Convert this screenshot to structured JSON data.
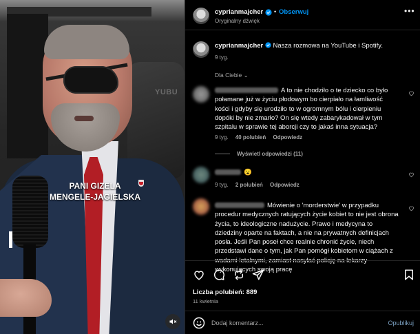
{
  "video": {
    "studio_sign": "YUBU",
    "caption_line1": "PANI GIZELA",
    "caption_line2": "MENGELE-JAGIELSKA"
  },
  "header": {
    "username": "cyprianmajcher",
    "separator": "•",
    "follow_label": "Obserwuj",
    "audio_label": "Oryginalny dźwięk",
    "more": "•••"
  },
  "caption": {
    "username": "cyprianmajcher",
    "text": "Nasza rozmowa na YouTube i Spotify.",
    "time": "9 tyg."
  },
  "filter": {
    "label": "Dla Ciebie",
    "chevron": "⌄"
  },
  "comments": [
    {
      "text": "A to nie chodziło o te dziecko co było połamane już w życiu płodowym bo cierpiało na łamliwość kości i gdyby się urodziło to w ogromnym bólu i cierpieniu dopóki by nie zmarło? On się wtedy zabarykadował w tym szpitalu w sprawie tej aborcji czy to jakaś inna sytuacja?",
      "time": "9 tyg.",
      "likes": "40 polubień",
      "reply": "Odpowiedz",
      "view_replies": "Wyświetl odpowiedzi (11)"
    },
    {
      "text": "😮",
      "time": "9 tyg.",
      "likes": "2 polubień",
      "reply": "Odpowiedz"
    },
    {
      "text": "Mówienie o 'morderstwie' w przypadku procedur medycznych ratujących życie kobiet to nie jest obrona życia, to ideologiczne nadużycie. Prawo i medycyna to dziedziny oparte na faktach, a nie na prywatnych definicjach posła. Jeśli Pan poseł chce realnie chronić życie, niech przedstawi dane o tym, jak Pan pomógł kobietom w ciążach z wadami letalnymi, zamiast nasyłać policję na lekarzy wykonujących swoją pracę"
    }
  ],
  "footer": {
    "likes": "Liczba polubień: 889",
    "date": "11 kwietnia",
    "comment_placeholder": "Dodaj komentarz...",
    "publish": "Opublikuj"
  },
  "colors": {
    "accent": "#0095f6",
    "verified": "#0095f6",
    "background": "#000000",
    "secondary_text": "#a8a8a8"
  },
  "icons": [
    "heart-icon",
    "comment-icon",
    "repost-icon",
    "share-icon",
    "bookmark-icon",
    "emoji-icon",
    "mute-icon",
    "verified-icon"
  ]
}
